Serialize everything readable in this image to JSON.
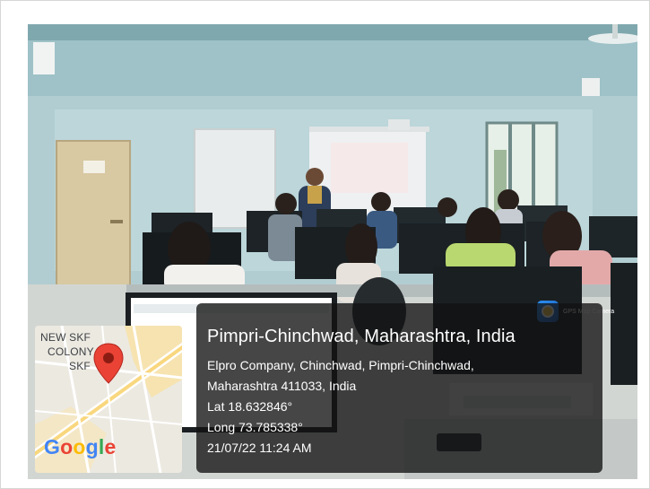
{
  "overlay": {
    "place": "Pimpri-Chinchwad, Maharashtra, India",
    "address_line_1": "Elpro Company, Chinchwad, Pimpri-Chinchwad,",
    "address_line_2": "Maharashtra 411033, India",
    "latitude": "Lat 18.632846°",
    "longitude": "Long 73.785338°",
    "datetime": "21/07/22 11:24 AM"
  },
  "badge": {
    "label": "GPS Map Camera",
    "icon": "gps-map-camera-icon"
  },
  "map": {
    "labels": [
      "NEW SKF",
      "COLONY",
      "SKF"
    ],
    "brand": [
      "G",
      "o",
      "o",
      "g",
      "l",
      "e"
    ],
    "brand_colors": [
      "#4285F4",
      "#EA4335",
      "#FBBC05",
      "#4285F4",
      "#34A853",
      "#EA4335"
    ],
    "pin_icon": "location-pin-icon",
    "pin_color": "#EA4335"
  }
}
